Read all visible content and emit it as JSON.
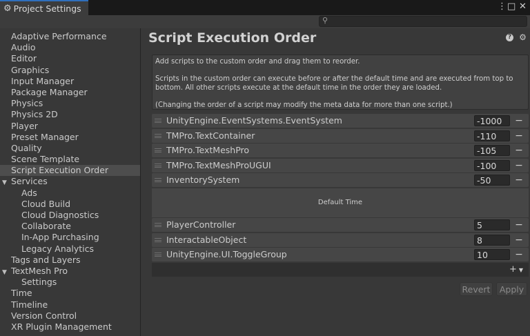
{
  "window": {
    "tab_title": "Project Settings",
    "tab_icon": "gear-icon",
    "menu_icon": "⋮",
    "maximize_icon": "□",
    "close_icon": "✕"
  },
  "search": {
    "placeholder": "",
    "value": ""
  },
  "sidebar": {
    "items": [
      {
        "label": "Adaptive Performance",
        "level": 0
      },
      {
        "label": "Audio",
        "level": 0
      },
      {
        "label": "Editor",
        "level": 0
      },
      {
        "label": "Graphics",
        "level": 0
      },
      {
        "label": "Input Manager",
        "level": 0
      },
      {
        "label": "Package Manager",
        "level": 0
      },
      {
        "label": "Physics",
        "level": 0
      },
      {
        "label": "Physics 2D",
        "level": 0
      },
      {
        "label": "Player",
        "level": 0
      },
      {
        "label": "Preset Manager",
        "level": 0
      },
      {
        "label": "Quality",
        "level": 0
      },
      {
        "label": "Scene Template",
        "level": 0
      },
      {
        "label": "Script Execution Order",
        "level": 0,
        "selected": true
      },
      {
        "label": "Services",
        "level": 0,
        "expanded": true
      },
      {
        "label": "Ads",
        "level": 1
      },
      {
        "label": "Cloud Build",
        "level": 1
      },
      {
        "label": "Cloud Diagnostics",
        "level": 1
      },
      {
        "label": "Collaborate",
        "level": 1
      },
      {
        "label": "In-App Purchasing",
        "level": 1
      },
      {
        "label": "Legacy Analytics",
        "level": 1
      },
      {
        "label": "Tags and Layers",
        "level": 0
      },
      {
        "label": "TextMesh Pro",
        "level": 0,
        "expanded": true
      },
      {
        "label": "Settings",
        "level": 1
      },
      {
        "label": "Time",
        "level": 0
      },
      {
        "label": "Timeline",
        "level": 0
      },
      {
        "label": "Version Control",
        "level": 0
      },
      {
        "label": "XR Plugin Management",
        "level": 0
      }
    ]
  },
  "main": {
    "title": "Script Execution Order",
    "help_text": [
      "Add scripts to the custom order and drag them to reorder.",
      "Scripts in the custom order can execute before or after the default time and are executed from top to bottom. All other scripts execute at the default time in the order they are loaded.",
      "(Changing the order of a script may modify the meta data for more than one script.)"
    ],
    "scripts_before": [
      {
        "name": "UnityEngine.EventSystems.EventSystem",
        "order": "-1000"
      },
      {
        "name": "TMPro.TextContainer",
        "order": "-110"
      },
      {
        "name": "TMPro.TextMeshPro",
        "order": "-105"
      },
      {
        "name": "TMPro.TextMeshProUGUI",
        "order": "-100"
      },
      {
        "name": "InventorySystem",
        "order": "-50"
      }
    ],
    "default_time_label": "Default Time",
    "scripts_after": [
      {
        "name": "PlayerController",
        "order": "5"
      },
      {
        "name": "InteractableObject",
        "order": "8"
      },
      {
        "name": "UnityEngine.UI.ToggleGroup",
        "order": "10"
      }
    ],
    "remove_label": "−",
    "add_label": "+",
    "revert_label": "Revert",
    "apply_label": "Apply"
  },
  "colors": {
    "background": "#383838",
    "tab_accent": "#2f6fbd",
    "selected_item": "#4d4d4d",
    "row": "#464646"
  }
}
